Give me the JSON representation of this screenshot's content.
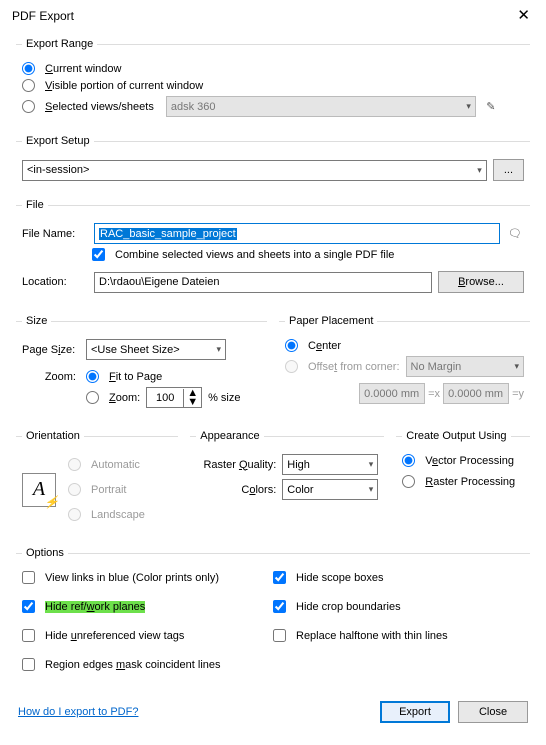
{
  "window": {
    "title": "PDF Export"
  },
  "exportRange": {
    "legend": "Export Range",
    "current": "Current window",
    "visible": "Visible portion of current window",
    "selected": "Selected views/sheets",
    "selectedSet": "adsk 360"
  },
  "exportSetup": {
    "legend": "Export Setup",
    "value": "<in-session>",
    "more": "..."
  },
  "file": {
    "legend": "File",
    "fileNameLabel": "File Name:",
    "fileName": "RAC_basic_sample_project",
    "combine": "Combine selected views and sheets into a single PDF file",
    "locationLabel": "Location:",
    "location": "D:\\rdaou\\Eigene Dateien",
    "browse": "Browse..."
  },
  "size": {
    "legend": "Size",
    "pageSizeLabel": "Page Size:",
    "pageSize": "<Use Sheet Size>",
    "zoomLabel": "Zoom:",
    "fit": "Fit to Page",
    "zoomRadio": "Zoom:",
    "zoomVal": "100",
    "zoomSuffix": "% size"
  },
  "paper": {
    "legend": "Paper Placement",
    "center": "Center",
    "offset": "Offset from corner:",
    "margin": "No Margin",
    "xval": "0.0000 mm",
    "xeq": "=x",
    "yval": "0.0000 mm",
    "yeq": "=y"
  },
  "orientation": {
    "legend": "Orientation",
    "auto": "Automatic",
    "portrait": "Portrait",
    "landscape": "Landscape"
  },
  "appearance": {
    "legend": "Appearance",
    "rqLabel": "Raster Quality:",
    "rq": "High",
    "colorsLabel": "Colors:",
    "colors": "Color"
  },
  "createUsing": {
    "legend": "Create Output Using",
    "vector": "Vector Processing",
    "raster": "Raster Processing"
  },
  "options": {
    "legend": "Options",
    "viewLinks": "View links in blue (Color prints only)",
    "hideScope": "Hide scope boxes",
    "hideRef": "Hide ref/work planes",
    "hideCrop": "Hide crop boundaries",
    "hideUnref": "Hide unreferenced view tags",
    "replaceHalftone": "Replace halftone with thin lines",
    "regionEdges": "Region edges mask coincident lines"
  },
  "footer": {
    "help": "How do I export to PDF?",
    "export": "Export",
    "close": "Close"
  }
}
